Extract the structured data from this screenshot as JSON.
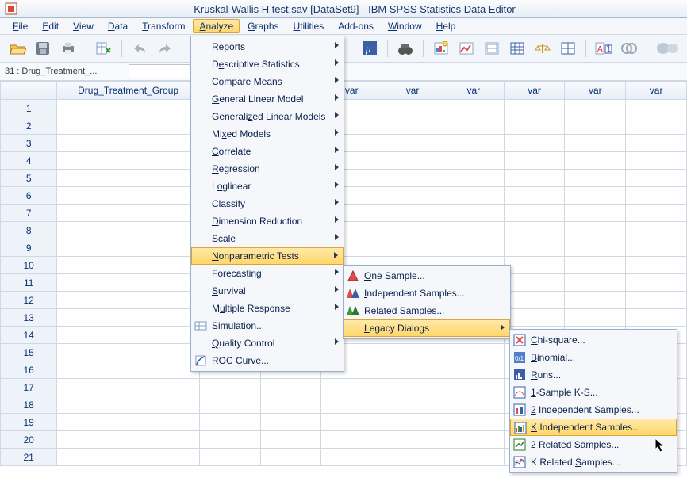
{
  "window": {
    "title": "Kruskal-Wallis H test.sav [DataSet9] - IBM SPSS Statistics Data Editor"
  },
  "menubar": {
    "items": [
      {
        "label": "File",
        "mn": "F"
      },
      {
        "label": "Edit",
        "mn": "E"
      },
      {
        "label": "View",
        "mn": "V"
      },
      {
        "label": "Data",
        "mn": "D"
      },
      {
        "label": "Transform",
        "mn": "T"
      },
      {
        "label": "Analyze",
        "mn": "A"
      },
      {
        "label": "Graphs",
        "mn": "G"
      },
      {
        "label": "Utilities",
        "mn": "U"
      },
      {
        "label": "Add-ons",
        "mn": ""
      },
      {
        "label": "Window",
        "mn": "W"
      },
      {
        "label": "Help",
        "mn": "H"
      }
    ],
    "active_index": 5
  },
  "infobar": {
    "cell_ref": "31 : Drug_Treatment_..."
  },
  "grid": {
    "columns": [
      "Drug_Treatment_Group",
      "var",
      "var",
      "var",
      "var",
      "var",
      "var",
      "var",
      "var"
    ],
    "row_count": 21
  },
  "analyze_menu": {
    "items": [
      {
        "label": "Reports",
        "mn": "",
        "sub": true
      },
      {
        "label": "Descriptive Statistics",
        "mn": "e",
        "sub": true
      },
      {
        "label": "Compare Means",
        "mn": "M",
        "sub": true
      },
      {
        "label": "General Linear Model",
        "mn": "G",
        "sub": true
      },
      {
        "label": "Generalized Linear Models",
        "mn": "z",
        "sub": true
      },
      {
        "label": "Mixed Models",
        "mn": "x",
        "sub": true
      },
      {
        "label": "Correlate",
        "mn": "C",
        "sub": true
      },
      {
        "label": "Regression",
        "mn": "R",
        "sub": true
      },
      {
        "label": "Loglinear",
        "mn": "o",
        "sub": true
      },
      {
        "label": "Classify",
        "mn": "F",
        "sub": true
      },
      {
        "label": "Dimension Reduction",
        "mn": "D",
        "sub": true
      },
      {
        "label": "Scale",
        "mn": "A",
        "sub": true
      },
      {
        "label": "Nonparametric Tests",
        "mn": "N",
        "sub": true,
        "highlight": true
      },
      {
        "label": "Forecasting",
        "mn": "T",
        "sub": true
      },
      {
        "label": "Survival",
        "mn": "S",
        "sub": true
      },
      {
        "label": "Multiple Response",
        "mn": "u",
        "sub": true
      },
      {
        "label": "Simulation...",
        "mn": "I",
        "sub": false,
        "icon": "sim"
      },
      {
        "label": "Quality Control",
        "mn": "Q",
        "sub": true
      },
      {
        "label": "ROC Curve...",
        "mn": "V",
        "sub": false,
        "icon": "roc"
      }
    ]
  },
  "nonparam_menu": {
    "items": [
      {
        "label": "One Sample...",
        "mn": "O",
        "icon": "tri-r"
      },
      {
        "label": "Independent Samples...",
        "mn": "I",
        "icon": "tri-b"
      },
      {
        "label": "Related Samples...",
        "mn": "R",
        "icon": "tri-g"
      },
      {
        "label": "Legacy Dialogs",
        "mn": "L",
        "sub": true,
        "highlight": true
      }
    ]
  },
  "legacy_menu": {
    "items": [
      {
        "label": "Chi-square...",
        "mn": "C",
        "icon": "chi"
      },
      {
        "label": "Binomial...",
        "mn": "B",
        "icon": "bin"
      },
      {
        "label": "Runs...",
        "mn": "R",
        "icon": "runs"
      },
      {
        "label": "1-Sample K-S...",
        "mn": "1",
        "icon": "ks"
      },
      {
        "label": "2 Independent Samples...",
        "mn": "2",
        "icon": "ind"
      },
      {
        "label": "K Independent Samples...",
        "mn": "K",
        "icon": "kind",
        "highlight": true
      },
      {
        "label": "2 Related Samples...",
        "mn": "L",
        "icon": "rel"
      },
      {
        "label": "K Related Samples...",
        "mn": "S",
        "icon": "krel"
      }
    ]
  }
}
